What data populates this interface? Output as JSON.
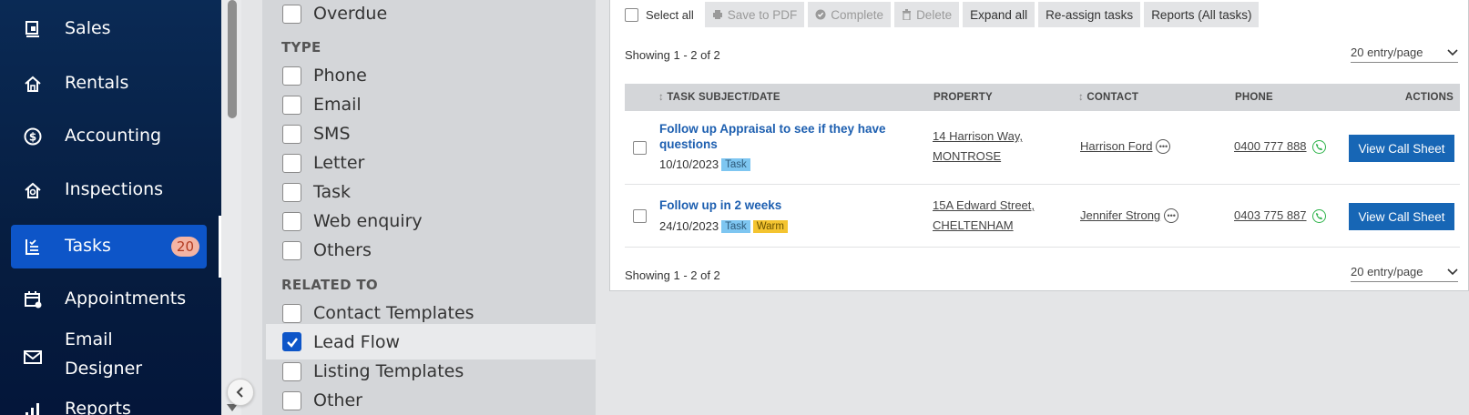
{
  "sidebar": {
    "items": [
      {
        "label": "Sales",
        "icon": "sales-icon"
      },
      {
        "label": "Rentals",
        "icon": "home-icon"
      },
      {
        "label": "Accounting",
        "icon": "dollar-icon"
      },
      {
        "label": "Inspections",
        "icon": "inspection-icon"
      },
      {
        "label": "Tasks",
        "icon": "tasks-icon",
        "badge": "20",
        "active": true
      },
      {
        "label": "Appointments",
        "icon": "calendar-icon"
      },
      {
        "label": "Email",
        "label2": "Designer",
        "icon": "mail-icon"
      },
      {
        "label": "Reports",
        "icon": "bar-chart-icon"
      }
    ]
  },
  "filters": {
    "status_items": [
      {
        "label": "Overdue",
        "checked": false
      }
    ],
    "type_heading": "TYPE",
    "type_items": [
      {
        "label": "Phone",
        "checked": false
      },
      {
        "label": "Email",
        "checked": false
      },
      {
        "label": "SMS",
        "checked": false
      },
      {
        "label": "Letter",
        "checked": false
      },
      {
        "label": "Task",
        "checked": false
      },
      {
        "label": "Web enquiry",
        "checked": false
      },
      {
        "label": "Others",
        "checked": false
      }
    ],
    "related_heading": "RELATED TO",
    "related_items": [
      {
        "label": "Contact Templates",
        "checked": false
      },
      {
        "label": "Lead Flow",
        "checked": true
      },
      {
        "label": "Listing Templates",
        "checked": false
      },
      {
        "label": "Other",
        "checked": false
      }
    ]
  },
  "toolbar": {
    "select_all": "Select all",
    "save_pdf": "Save to PDF",
    "complete": "Complete",
    "delete": "Delete",
    "expand_all": "Expand all",
    "reassign": "Re-assign tasks",
    "reports": "Reports (All tasks)"
  },
  "pagination": {
    "showing_top": "Showing 1 - 2 of 2",
    "showing_bottom": "Showing 1 - 2 of 2",
    "per_page": "20 entry/page"
  },
  "table": {
    "headers": {
      "subject": "TASK SUBJECT/DATE",
      "property": "PROPERTY",
      "contact": "CONTACT",
      "phone": "PHONE",
      "actions": "ACTIONS"
    },
    "rows": [
      {
        "subject": "Follow up Appraisal to see if they have questions",
        "date": "10/10/2023",
        "tags": [
          "Task"
        ],
        "property_line1": "14 Harrison Way,",
        "property_line2": "MONTROSE",
        "contact": "Harrison Ford",
        "phone": "0400 777 888",
        "action": "View Call Sheet"
      },
      {
        "subject": "Follow up in 2 weeks",
        "date": "24/10/2023",
        "tags": [
          "Task",
          "Warm"
        ],
        "property_line1": "15A Edward Street,",
        "property_line2": "CHELTENHAM",
        "contact": "Jennifer Strong",
        "phone": "0403 775 887",
        "action": "View Call Sheet"
      }
    ]
  },
  "colors": {
    "sidebar_bg": "#0a2a55",
    "active_nav": "#0d55c8",
    "link_blue": "#1d5fb0",
    "button_blue": "#1766b5",
    "tag_task": "#7ec6f1",
    "tag_warm": "#f4c430"
  }
}
